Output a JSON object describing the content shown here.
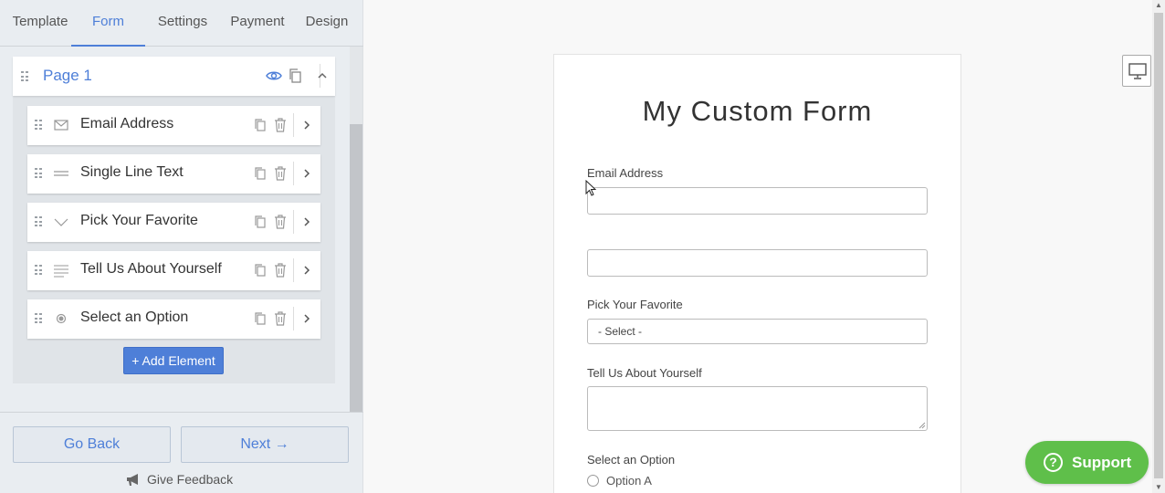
{
  "tabs": [
    "Template",
    "Form",
    "Settings",
    "Payment",
    "Design"
  ],
  "active_tab": "Form",
  "page": {
    "title": "Page 1"
  },
  "elements": [
    {
      "label": "Email Address",
      "icon": "envelope-icon"
    },
    {
      "label": "Single Line Text",
      "icon": "lines-icon"
    },
    {
      "label": "Pick Your Favorite",
      "icon": "chevron-down-icon"
    },
    {
      "label": "Tell Us About Yourself",
      "icon": "paragraph-icon"
    },
    {
      "label": "Select an Option",
      "icon": "radio-icon"
    }
  ],
  "add_element_label": "+ Add Element",
  "go_back_label": "Go Back",
  "next_label": "Next →",
  "feedback_label": "Give Feedback",
  "form": {
    "title": "My Custom Form",
    "email_label": "Email Address",
    "pick_label": "Pick Your Favorite",
    "select_value": "- Select -",
    "tell_label": "Tell Us About Yourself",
    "option_label": "Select an Option",
    "option_a": "Option A"
  },
  "support_label": "Support",
  "colors": {
    "accent": "#4e7fd8",
    "support": "#5fbf4a"
  }
}
